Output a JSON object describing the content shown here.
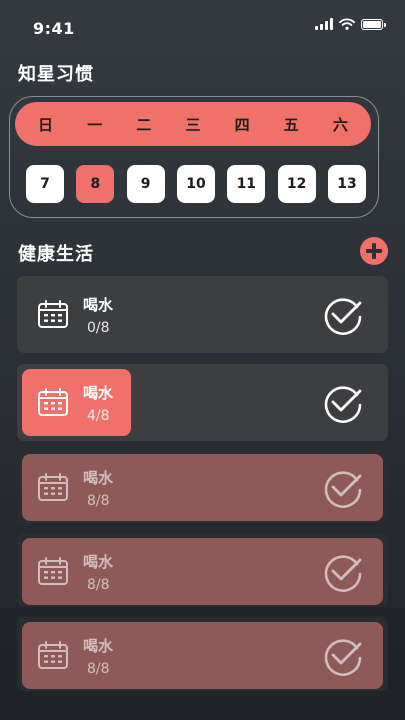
{
  "status_bar": {
    "time": "9:41",
    "battery_level": 1.0
  },
  "header": {
    "title": "知星习惯"
  },
  "calendar": {
    "weekdays": [
      "日",
      "一",
      "二",
      "三",
      "四",
      "五",
      "六"
    ],
    "dates": [
      "7",
      "8",
      "9",
      "10",
      "11",
      "12",
      "13"
    ],
    "selected_date": "8"
  },
  "section": {
    "title": "健康生活",
    "add_icon": "plus-circle-icon"
  },
  "habits": [
    {
      "title": "喝水",
      "count": "0/8",
      "progress": 0.0,
      "icon": "calendar-icon",
      "check_icon": "checkmark-circle-icon"
    },
    {
      "title": "喝水",
      "count": "4/8",
      "progress": 0.5,
      "icon": "calendar-icon",
      "check_icon": "checkmark-circle-icon"
    },
    {
      "title": "喝水",
      "count": "8/8",
      "progress": 1.0,
      "icon": "calendar-icon",
      "check_icon": "checkmark-circle-icon"
    },
    {
      "title": "喝水",
      "count": "8/8",
      "progress": 1.0,
      "icon": "calendar-icon",
      "check_icon": "checkmark-circle-icon"
    },
    {
      "title": "喝水",
      "count": "8/8",
      "progress": 1.0,
      "icon": "calendar-icon",
      "check_icon": "checkmark-circle-icon"
    }
  ],
  "colors": {
    "accent": "#f0716a",
    "done": "#8e5a58",
    "card": "#3d3e40"
  }
}
